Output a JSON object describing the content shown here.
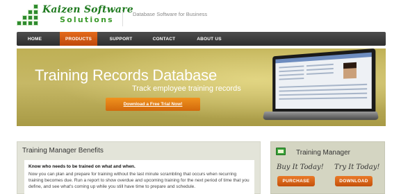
{
  "header": {
    "logo_line1": "Kaizen Software",
    "logo_line2": "Solutions",
    "tagline": "Database Software for Business"
  },
  "nav": {
    "items": [
      {
        "label": "HOME",
        "active": false
      },
      {
        "label": "PRODUCTS",
        "active": true
      },
      {
        "label": "SUPPORT",
        "active": false
      },
      {
        "label": "CONTACT",
        "active": false
      },
      {
        "label": "ABOUT US",
        "active": false
      }
    ]
  },
  "hero": {
    "title": "Training Records Database",
    "subtitle": "Track employee training records",
    "cta_label": "Download a Free Trial Now!"
  },
  "benefits": {
    "title": "Training Manager Benefits",
    "heading": "Know who needs to be trained on what and when.",
    "text": "Now you can plan and prepare for training without the last minute scrambling that occurs when recurring training becomes due. Run a report to show overdue and upcoming training for the next period of time that you define, and see what's coming up while you still have time to prepare and schedule."
  },
  "product": {
    "title": "Training Manager",
    "buy_label": "Buy It Today!",
    "try_label": "Try It Today!",
    "purchase_label": "PURCHASE",
    "download_label": "DOWNLOAD"
  },
  "colors": {
    "brand_green": "#2e8b2e",
    "accent_orange": "#e36b1c",
    "nav_dark": "#3a3a3a",
    "hero_olive": "#c6b866"
  },
  "icons": {
    "logo": "green-cube-staircase-icon",
    "product": "training-manager-app-icon"
  }
}
